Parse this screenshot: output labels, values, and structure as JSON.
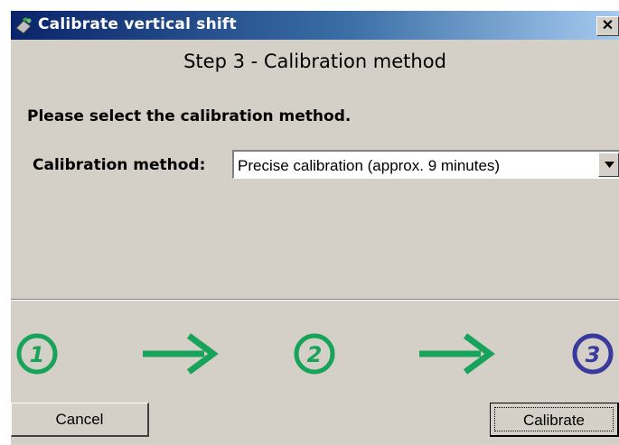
{
  "window": {
    "title": "Calibrate vertical shift",
    "close_glyph": "✕"
  },
  "step": {
    "heading": "Step 3 - Calibration method",
    "instruction": "Please select the calibration method."
  },
  "method": {
    "label": "Calibration method:",
    "selected": "Precise calibration (approx. 9 minutes)"
  },
  "progress": {
    "steps": [
      "1",
      "2",
      "3"
    ],
    "current_step": 3,
    "completed_color": "#17a45a",
    "current_color": "#3a3a9e"
  },
  "buttons": {
    "cancel": "Cancel",
    "calibrate": "Calibrate"
  }
}
